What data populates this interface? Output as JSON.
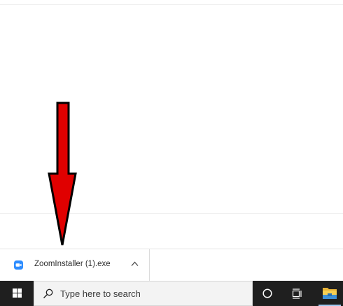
{
  "download_bar": {
    "item": {
      "file_name": "ZoomInstaller (1).exe",
      "icon": "zoom-app-icon",
      "expand_icon": "chevron-up-icon"
    }
  },
  "annotation": {
    "icon": "down-arrow-annotation",
    "color": "#e00000"
  },
  "taskbar": {
    "start_icon": "windows-logo-icon",
    "search": {
      "icon": "search-icon",
      "placeholder": "Type here to search"
    },
    "cortana_icon": "cortana-circle-icon",
    "task_view_icon": "task-view-icon",
    "pinned_apps": [
      {
        "icon": "file-explorer-icon"
      }
    ]
  },
  "colors": {
    "taskbar_bg": "#1f1f1f",
    "zoom_blue": "#2d8cff",
    "arrow_red": "#e00000"
  }
}
